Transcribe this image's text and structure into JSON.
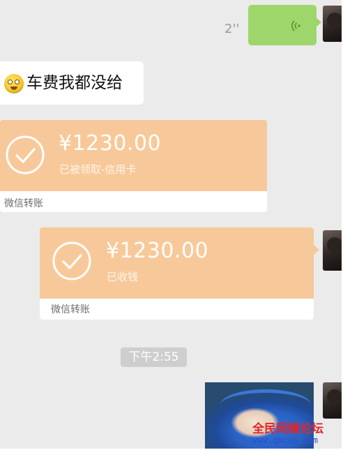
{
  "voice_message": {
    "duration": "2''"
  },
  "text_message": {
    "text": "车费我都没给"
  },
  "transfers": [
    {
      "amount": "¥1230.00",
      "status": "已被领取-信用卡",
      "footer": "微信转账"
    },
    {
      "amount": "¥1230.00",
      "status": "已收钱",
      "footer": "微信转账"
    }
  ],
  "timestamp": "下午2:55",
  "watermark": {
    "title": "全民网赚论坛",
    "url": "www.qmceo.com"
  },
  "colors": {
    "chat_background": "#ebebeb",
    "voice_bubble": "#9ed66b",
    "transfer_card": "#f7c99a",
    "watermark_title": "#e1262b",
    "watermark_url": "#2c4fc8"
  }
}
